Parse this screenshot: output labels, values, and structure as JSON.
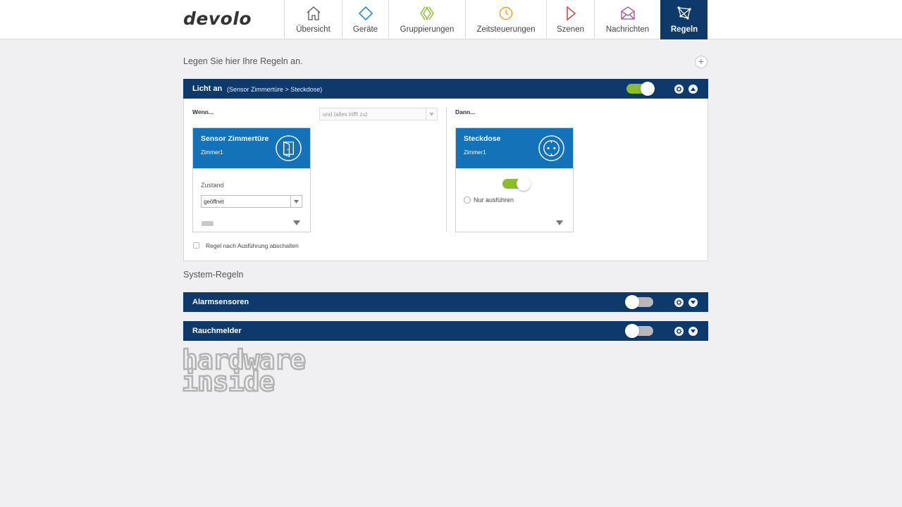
{
  "header": {
    "logo": "devolo",
    "nav": [
      {
        "label": "Übersicht",
        "icon": "home-icon"
      },
      {
        "label": "Geräte",
        "icon": "diamond-icon"
      },
      {
        "label": "Gruppierungen",
        "icon": "chevrons-icon"
      },
      {
        "label": "Zeitsteuerungen",
        "icon": "clock-icon"
      },
      {
        "label": "Szenen",
        "icon": "play-icon"
      },
      {
        "label": "Nachrichten",
        "icon": "envelope-icon"
      },
      {
        "label": "Regeln",
        "icon": "network-icon",
        "active": true
      }
    ]
  },
  "intro": "Legen Sie hier Ihre Regeln an.",
  "rule": {
    "title": "Licht an",
    "subtitle": "(Sensor Zimmertüre > Steckdose)",
    "enabled": true,
    "when_label": "Wenn...",
    "condition_select": "und (alles trifft zu)",
    "then_label": "Dann...",
    "trigger_card": {
      "title": "Sensor Zimmertüre",
      "room": "Zimmer1",
      "icon": "door-icon",
      "state_label": "Zustand",
      "state_value": "geöffnet"
    },
    "action_card": {
      "title": "Steckdose",
      "room": "Zimmer1",
      "icon": "socket-icon",
      "switch_on": true,
      "execute_only_label": "Nur ausführen"
    },
    "disable_after_label": "Regel nach Ausführung abschalten"
  },
  "system_rules": {
    "title": "System-Regeln",
    "items": [
      {
        "title": "Alarmsensoren",
        "enabled": false
      },
      {
        "title": "Rauchmelder",
        "enabled": false
      }
    ]
  },
  "watermark": {
    "line1": "hardware",
    "line2": "inside"
  },
  "colors": {
    "navy": "#0e3a6b",
    "card_blue": "#1472b9",
    "toggle_green": "#8cbd2c",
    "nav_diamond": "#1a7fc4",
    "nav_chevrons": "#8cbd2c",
    "nav_clock": "#f0a020",
    "nav_play": "#c8343c",
    "nav_envelope": "#9b4f96"
  }
}
